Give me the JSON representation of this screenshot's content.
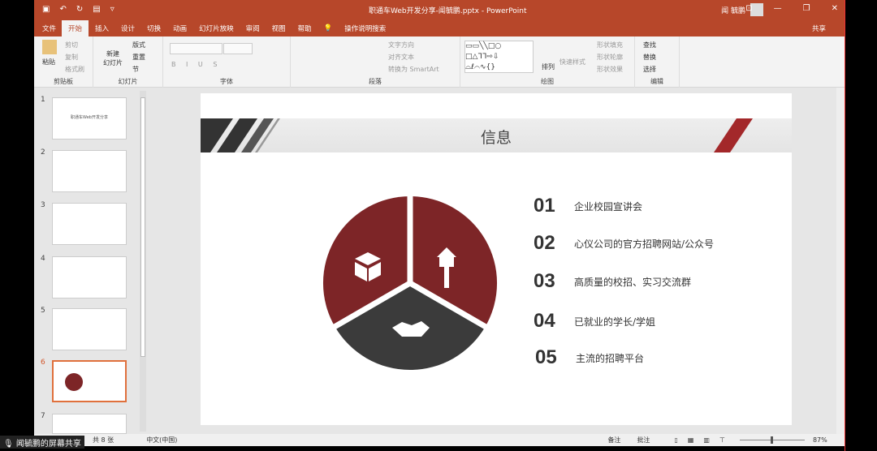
{
  "window": {
    "title": "职通车Web开发分享-闻毓鹏.pptx - PowerPoint",
    "user": "闻 毓鹏",
    "quick_access": [
      "save-icon",
      "undo-icon",
      "redo-icon",
      "present-icon",
      "customize-icon"
    ]
  },
  "tabs": [
    "文件",
    "开始",
    "插入",
    "设计",
    "切换",
    "动画",
    "幻灯片放映",
    "审阅",
    "视图",
    "帮助"
  ],
  "active_tab": "开始",
  "tell_me": "操作说明搜索",
  "share": "共享",
  "ribbon": {
    "clipboard": {
      "label": "剪贴板",
      "paste": "粘贴",
      "cut": "剪切",
      "copy": "复制",
      "format_painter": "格式刷"
    },
    "slides": {
      "label": "幻灯片",
      "new_slide": "新建\n幻灯片",
      "layout": "版式",
      "reset": "重置",
      "section": "节"
    },
    "font": {
      "label": "字体"
    },
    "paragraph": {
      "label": "段落",
      "text_direction": "文字方向",
      "align_text": "对齐文本",
      "smartart": "转换为 SmartArt"
    },
    "drawing": {
      "label": "绘图",
      "arrange": "排列",
      "quick_styles": "快速样式",
      "fill": "形状填充",
      "outline": "形状轮廓",
      "effects": "形状效果"
    },
    "editing": {
      "label": "编辑",
      "find": "查找",
      "replace": "替换",
      "select": "选择"
    }
  },
  "thumbnails": [
    {
      "num": "1",
      "caption": "职通车Web开发分享"
    },
    {
      "num": "2"
    },
    {
      "num": "3"
    },
    {
      "num": "4"
    },
    {
      "num": "5"
    },
    {
      "num": "6",
      "selected": true
    },
    {
      "num": "7"
    }
  ],
  "slide": {
    "title": "信息",
    "pie_icons": [
      "box-icon",
      "house-key-icon",
      "handshake-icon"
    ],
    "items": [
      {
        "num": "01",
        "text": "企业校园宣讲会"
      },
      {
        "num": "02",
        "text": "心仪公司的官方招聘网站/公众号"
      },
      {
        "num": "03",
        "text": "高质量的校招、实习交流群"
      },
      {
        "num": "04",
        "text": "已就业的学长/学姐"
      },
      {
        "num": "05",
        "text": "主流的招聘平台"
      }
    ],
    "colors": {
      "red": "#7d2527",
      "dark": "#3b3b3b",
      "accent": "#b7472a"
    }
  },
  "status": {
    "slide_count": "共 8 张",
    "language": "中文(中国)",
    "notes": "备注",
    "comments": "批注",
    "zoom": "87%",
    "zoom_percent": 87
  },
  "screen_share": "闻毓鹏的屏幕共享"
}
